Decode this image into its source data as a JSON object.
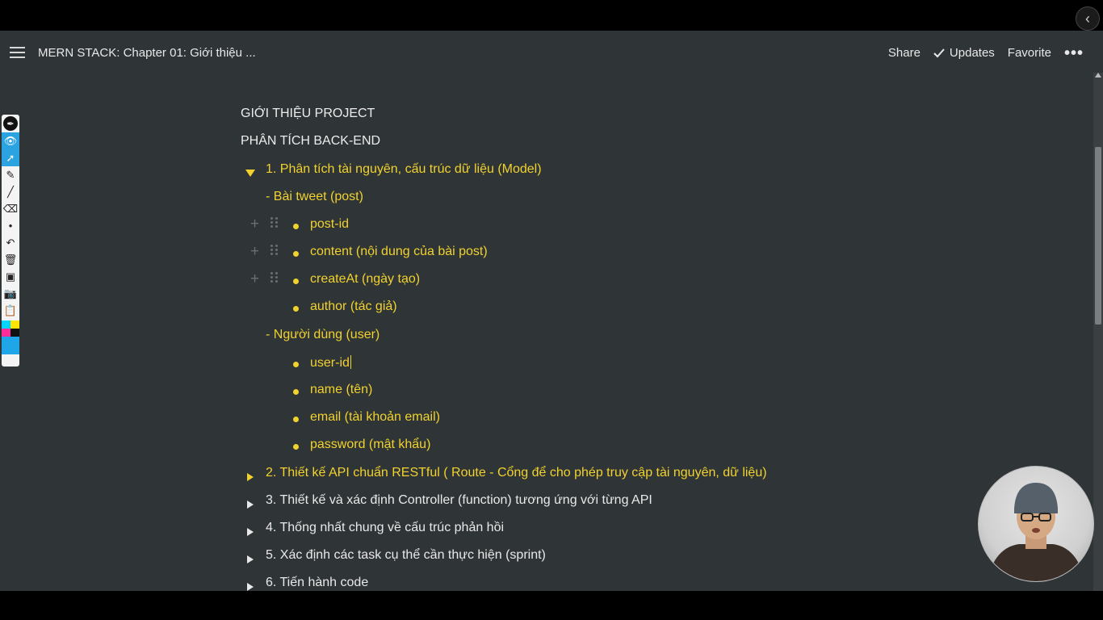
{
  "window": {
    "back_icon": "chevron-left-icon"
  },
  "header": {
    "menu_icon": "hamburger-menu-icon",
    "title": "MERN STACK: Chapter 01: Giới thiệu ...",
    "share_label": "Share",
    "updates_label": "Updates",
    "favorite_label": "Favorite",
    "more_icon": "more-options-icon"
  },
  "annotation_toolbar": {
    "tools": [
      "pen-icon",
      "eye-icon",
      "cursor-icon",
      "highlighter-icon",
      "line-icon",
      "eraser-icon",
      "dot-icon",
      "undo-icon",
      "trash-icon",
      "screen-icon",
      "camera-icon",
      "clipboard-icon"
    ],
    "colors": [
      "#00d4ff",
      "#ffe600",
      "#ff2d9a",
      "#111111",
      "#1ea6e8"
    ]
  },
  "document": {
    "heading1": "GIỚI THIỆU PROJECT",
    "heading2": "PHÂN TÍCH BACK-END",
    "sections": [
      {
        "label": "1. Phân tích tài nguyên, cấu trúc dữ liệu (Model)",
        "expanded": true,
        "color": "#f1d22e"
      },
      {
        "label": "2. Thiết kế API chuẩn RESTful ( Route - Cổng để cho phép truy cập tài nguyên, dữ liệu)",
        "expanded": false,
        "color": "#f1d22e"
      },
      {
        "label": "3. Thiết kế và xác định Controller (function) tương ứng với từng API",
        "expanded": false,
        "color": "#e9e9e9"
      },
      {
        "label": "4. Thống nhất chung về cấu trúc phản hồi",
        "expanded": false,
        "color": "#e9e9e9"
      },
      {
        "label": "5. Xác định các task cụ thể cần thực hiện (sprint)",
        "expanded": false,
        "color": "#e9e9e9"
      },
      {
        "label": "6. Tiến hành code",
        "expanded": false,
        "color": "#e9e9e9"
      }
    ],
    "groups": [
      {
        "label": "- Bài tweet (post)",
        "items": [
          "post-id",
          "content (nội dung của bài post)",
          "createAt (ngày tạo)",
          "author (tác giả)"
        ]
      },
      {
        "label": "- Người dùng (user)",
        "items": [
          "user-id",
          "name (tên)",
          "email (tài khoản email)",
          "password (mật khẩu)"
        ]
      }
    ]
  }
}
